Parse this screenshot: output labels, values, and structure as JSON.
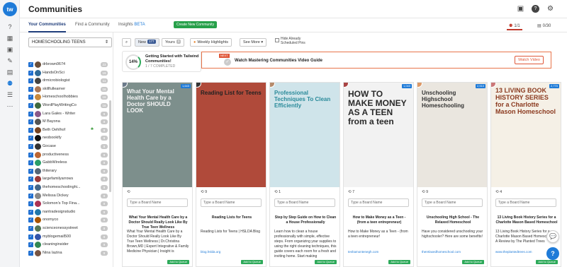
{
  "app": {
    "title": "Communities",
    "logo": "tw"
  },
  "rail": [
    {
      "icon": "help-circle-icon",
      "glyph": "?"
    },
    {
      "icon": "calendar-icon",
      "glyph": "▦"
    },
    {
      "icon": "image-icon",
      "glyph": "▣"
    },
    {
      "icon": "pen-icon",
      "glyph": "✎"
    },
    {
      "icon": "chart-icon",
      "glyph": "▤"
    },
    {
      "icon": "people-icon",
      "glyph": "⚉"
    },
    {
      "icon": "list-icon",
      "glyph": "☰"
    },
    {
      "icon": "more-icon",
      "glyph": "⋯"
    }
  ],
  "nav": {
    "tabs": [
      "Your Communities",
      "Find a Community",
      "Insights"
    ],
    "beta": "BETA",
    "create": "Create New Community",
    "stat1": "1/1",
    "stat2": "0/30"
  },
  "left": {
    "select": "HOMESCHOOLING TEENS",
    "accounts": [
      {
        "name": "drbrown0674",
        "count": "23"
      },
      {
        "name": "HandsOnSci",
        "count": "19"
      },
      {
        "name": "drmicrobiologist",
        "count": "11"
      },
      {
        "name": "skillfullearner",
        "count": "16"
      },
      {
        "name": "Homeschoolhobbies",
        "count": "16"
      },
      {
        "name": "WordPlayWritingCo",
        "count": "16"
      },
      {
        "name": "Lara Gales - Writer",
        "count": "9"
      },
      {
        "name": "M Bayona",
        "count": "9"
      },
      {
        "name": "Beth Oehlhof",
        "count": "9",
        "leaf": true
      },
      {
        "name": "neobookify",
        "count": "9"
      },
      {
        "name": "Gocase",
        "count": "9"
      },
      {
        "name": "productiveness",
        "count": "9"
      },
      {
        "name": "GabbWireless",
        "count": "9"
      },
      {
        "name": "thiterary",
        "count": "9"
      },
      {
        "name": "largefamilyarrows",
        "count": "9"
      },
      {
        "name": "thehomeschoolinghi...",
        "count": "9"
      },
      {
        "name": "Melissa Dickey",
        "count": "9"
      },
      {
        "name": "Solomon's Top Fina...",
        "count": "9"
      },
      {
        "name": "nantradesignstudio",
        "count": "9"
      },
      {
        "name": "onomyco",
        "count": "9"
      },
      {
        "name": "scienceonessystreet",
        "count": "9"
      },
      {
        "name": "myblogemail500",
        "count": "9"
      },
      {
        "name": "cleaninginsider",
        "count": "9"
      },
      {
        "name": "Nina Iazina",
        "count": "9"
      }
    ]
  },
  "toolbar": {
    "new_label": "New",
    "new_count": "177",
    "yours_label": "Yours",
    "yours_count": "0",
    "weekly": "Weekly Highlights",
    "see_more": "See More",
    "hide_label": "Hide Already Scheduled Pins"
  },
  "progress": {
    "percent": "14%",
    "title": "Getting Started with Tailwind Communities!",
    "sub": "1 / 7 COMPLETED",
    "next": "NEXT",
    "guide": "Watch Mastering Communities Video Guide",
    "watch": "Watch Video"
  },
  "cards": [
    {
      "img_title": "What Your Mental Health Care by a Doctor SHOULD LOOK",
      "bg": "#7d8f8c",
      "tcolor": "#f5f5f5",
      "count": "",
      "t1": "What Your Mental Health Care by a Doctor Should Really Look Like By True Teen Wellness",
      "d1": "What Your Mental Health Care by a Doctor Should Really Look Like By True Teen Wellness | Dr.Christina Brown,MD | Expert Integrative & Family Medicine Physician | Insight is",
      "src": "",
      "badge": "1,643"
    },
    {
      "img_title": "Reading List for Teens",
      "bg": "#b04a3a",
      "tcolor": "#222",
      "count": "9",
      "t1": "Reading Lists for Teens",
      "d1": "Reading Lists for Teens | HSLDA Blog",
      "src": "blog.hslda.org",
      "badge": ""
    },
    {
      "img_title": "Professional Techniques To Clean Efficiently",
      "bg": "#cfe4ea",
      "tcolor": "#2a8a9a",
      "count": "1",
      "t1": "Step by Step Guide on How to Clean a House Professionally",
      "d1": "Learn how to clean a house professionally with simple, effective steps. From organizing your supplies to using the right cleaning techniques, this guide covers each room for a fresh and inviting home. Start making",
      "src": "",
      "badge": ""
    },
    {
      "img_title": "HOW TO MAKE MONEY AS A TEEN from a teen",
      "bg": "#f2f2f2",
      "tcolor": "#2a2a2a",
      "count": "7",
      "t1": "How to Make Money as a Teen - (from a teen entrepreneur)",
      "d1": "How to Make Money as a Teen - (from a teen entrepreneur!",
      "src": "teshamontenegh.com",
      "badge": "1,043"
    },
    {
      "img_title": "Unschooling Highschool Homeschooling",
      "bg": "#eae6df",
      "tcolor": "#333",
      "count": "9",
      "t1": "Unschooling High School - The Relaxed Homeschool",
      "d1": "Have you considered unschooling your highschooler? Here are some benefits!",
      "src": "therelaxedhomeschool.com",
      "badge": "2,510"
    },
    {
      "img_title": "13 LIVING BOOK HISTORY SERIES for a Charlotte Mason Homeschool",
      "bg": "#f5f0e6",
      "tcolor": "#8b3a1f",
      "count": "4",
      "t1": "13 Living Book History Series for a Charlotte Mason Based Homeschool",
      "d1": "13 Living Book History Series for a Charlotte Mason Based Homeschool - A Review by The Planted Trees",
      "src": "www.theplantedtrees.com",
      "badge": "2,770"
    }
  ],
  "placeholder": "Type a Board Name",
  "queue": "Add to Queue"
}
